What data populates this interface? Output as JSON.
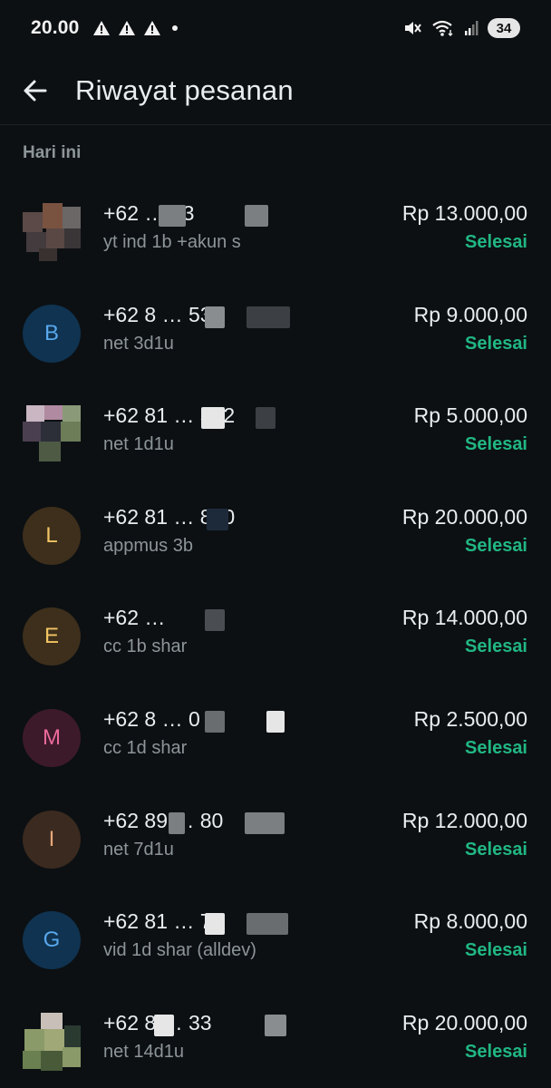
{
  "status_bar": {
    "time": "20.00",
    "battery": "34"
  },
  "header": {
    "title": "Riwayat pesanan"
  },
  "section": {
    "label": "Hari ini"
  },
  "colors": {
    "background": "#0c1013",
    "accent_status": "#21b783",
    "text_primary": "#e9edef",
    "text_secondary": "#8d9599"
  },
  "orders": [
    {
      "phone": "+62 … 23",
      "desc": "yt ind 1b +akun s",
      "amount": "Rp 13.000,00",
      "status": "Selesai",
      "avatar_letter": "",
      "avatar_bg": "",
      "avatar_fg": ""
    },
    {
      "phone": "+62 8 … 533",
      "desc": "net 3d1u",
      "amount": "Rp 9.000,00",
      "status": "Selesai",
      "avatar_letter": "B",
      "avatar_bg": "#0f3350",
      "avatar_fg": "#58a8ec"
    },
    {
      "phone": "+62 81 … 502",
      "desc": "net 1d1u",
      "amount": "Rp 5.000,00",
      "status": "Selesai",
      "avatar_letter": "",
      "avatar_bg": "",
      "avatar_fg": ""
    },
    {
      "phone": "+62 81 … 810",
      "desc": "appmus 3b",
      "amount": "Rp 20.000,00",
      "status": "Selesai",
      "avatar_letter": "L",
      "avatar_bg": "#3d2f1b",
      "avatar_fg": "#f2c463"
    },
    {
      "phone": "+62 …",
      "desc": "cc 1b shar",
      "amount": "Rp 14.000,00",
      "status": "Selesai",
      "avatar_letter": "E",
      "avatar_bg": "#3d2f1b",
      "avatar_fg": "#f2c463"
    },
    {
      "phone": "+62 8 … 0",
      "desc": "cc 1d shar",
      "amount": "Rp 2.500,00",
      "status": "Selesai",
      "avatar_letter": "M",
      "avatar_bg": "#3d1a2a",
      "avatar_fg": "#ec6a9c"
    },
    {
      "phone": "+62 89 … 80",
      "desc": "net 7d1u",
      "amount": "Rp 12.000,00",
      "status": "Selesai",
      "avatar_letter": "I",
      "avatar_bg": "#3b2a1f",
      "avatar_fg": "#e6a77a"
    },
    {
      "phone": "+62 81 … 70",
      "desc": "vid 1d shar (alldev)",
      "amount": "Rp 8.000,00",
      "status": "Selesai",
      "avatar_letter": "G",
      "avatar_bg": "#0f3350",
      "avatar_fg": "#58a8ec"
    },
    {
      "phone": "+62 8 … 33",
      "desc": "net 14d1u",
      "amount": "Rp 20.000,00",
      "status": "Selesai",
      "avatar_letter": "",
      "avatar_bg": "",
      "avatar_fg": ""
    }
  ]
}
